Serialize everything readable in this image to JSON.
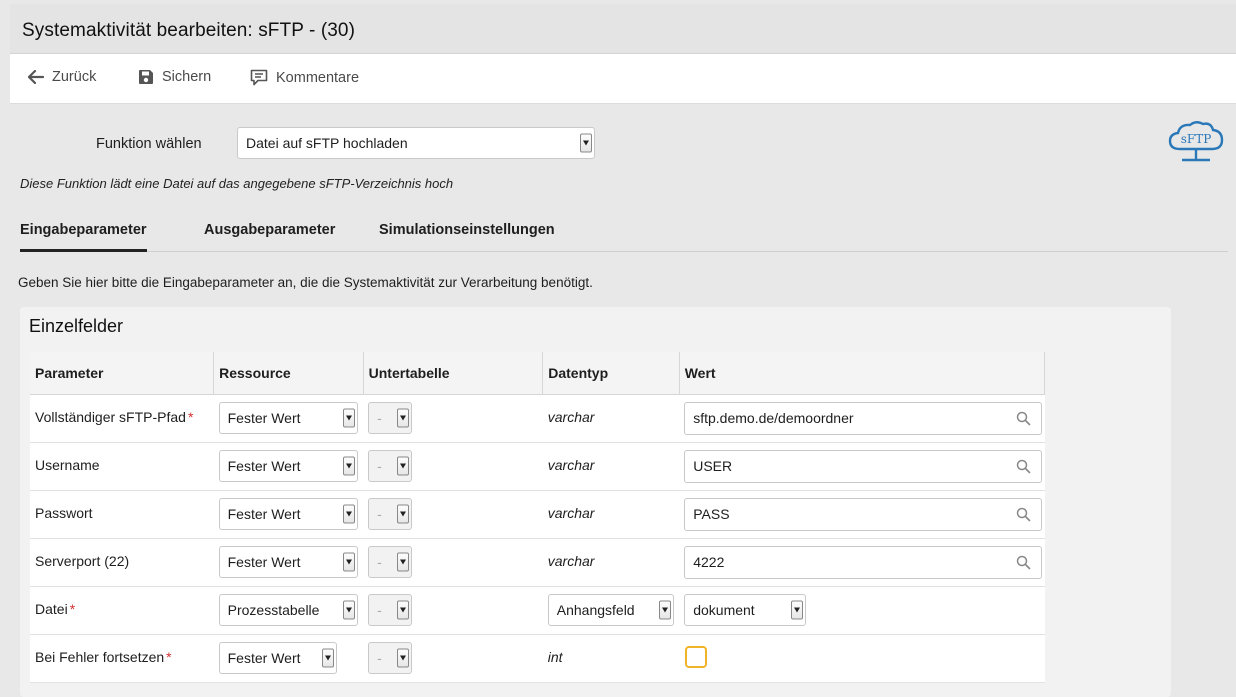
{
  "title": "Systemaktivität bearbeiten: sFTP - (30)",
  "toolbar": {
    "back_label": "Zurück",
    "save_label": "Sichern",
    "comments_label": "Kommentare"
  },
  "function": {
    "label": "Funktion wählen",
    "selected": "Datei auf sFTP hochladen",
    "description": "Diese Funktion lädt eine Datei auf das angegebene sFTP-Verzeichnis hoch"
  },
  "logo_text": "sFTP",
  "tabs": [
    {
      "label": "Eingabeparameter",
      "active": true
    },
    {
      "label": "Ausgabeparameter",
      "active": false
    },
    {
      "label": "Simulationseinstellungen",
      "active": false
    }
  ],
  "intro": "Geben Sie hier bitte die Eingabeparameter an, die die Systemaktivität zur Verarbeitung benötigt.",
  "panel": {
    "title": "Einzelfelder",
    "columns": [
      "Parameter",
      "Ressource",
      "Untertabelle",
      "Datentyp",
      "Wert"
    ],
    "rows": [
      {
        "parameter": "Vollständiger sFTP-Pfad",
        "required": "*",
        "resource": "Fester Wert",
        "subtable": "-",
        "datatype": "varchar",
        "value": "sftp.demo.de/demoordner"
      },
      {
        "parameter": "Username",
        "required": "",
        "resource": "Fester Wert",
        "subtable": "-",
        "datatype": "varchar",
        "value": "USER"
      },
      {
        "parameter": "Passwort",
        "required": "",
        "resource": "Fester Wert",
        "subtable": "-",
        "datatype": "varchar",
        "value": "PASS"
      },
      {
        "parameter": "Serverport (22)",
        "required": "",
        "resource": "Fester Wert",
        "subtable": "-",
        "datatype": "varchar",
        "value": "4222"
      },
      {
        "parameter": "Datei",
        "required": "*",
        "resource": "Prozesstabelle",
        "subtable": "-",
        "datatype_select": "Anhangsfeld",
        "value_select": "dokument"
      },
      {
        "parameter": "Bei Fehler fortsetzen",
        "required": "*",
        "resource": "Fester Wert",
        "subtable": "-",
        "datatype": "int",
        "value_checked": false
      }
    ]
  },
  "colors": {
    "required_star": "#d32f2f",
    "checkbox_border": "#f0b429",
    "logo": "#2b78b8"
  }
}
